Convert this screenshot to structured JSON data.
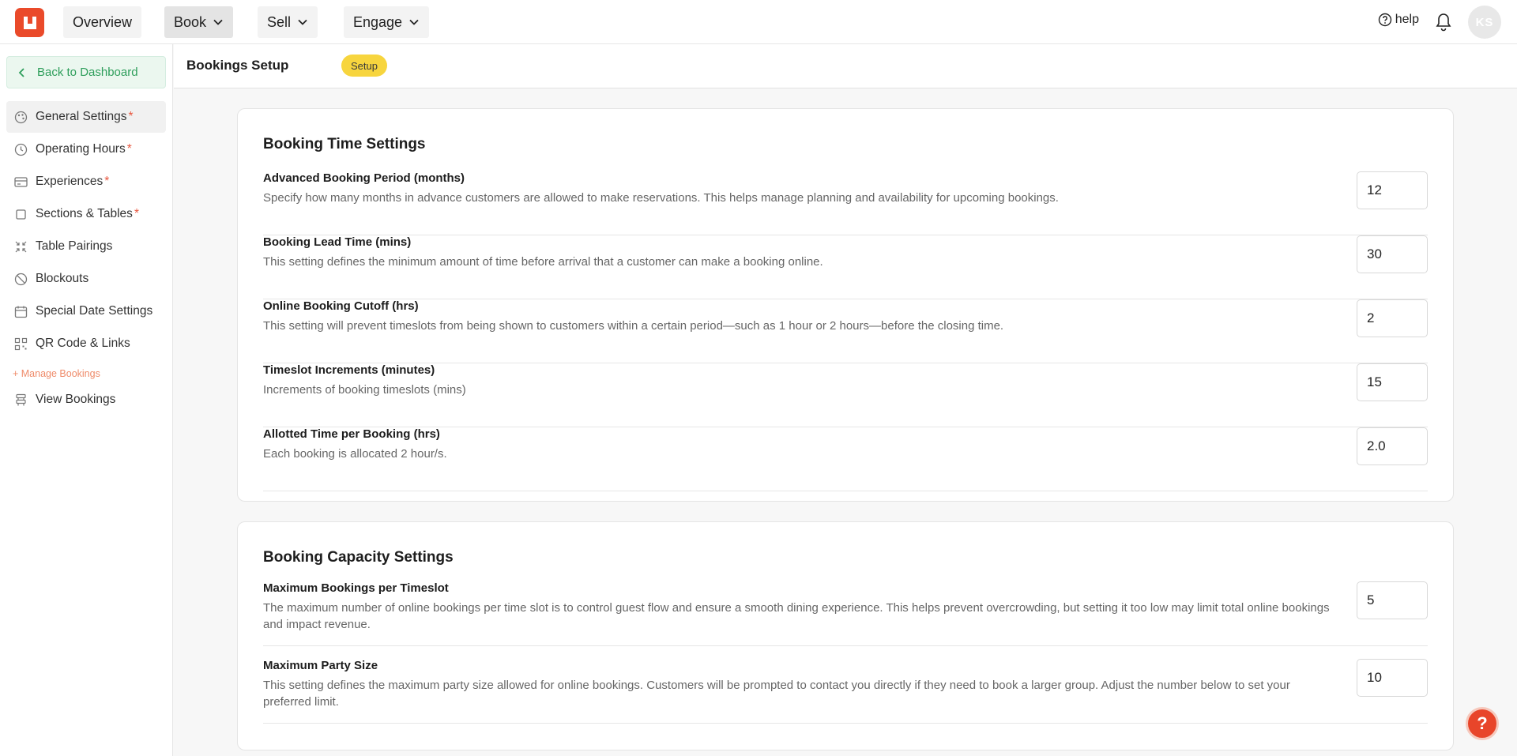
{
  "nav": {
    "items": [
      {
        "label": "Overview"
      },
      {
        "label": "Book"
      },
      {
        "label": "Sell"
      },
      {
        "label": "Engage"
      }
    ],
    "help_label": "help",
    "avatar_initials": "KS"
  },
  "sidebar": {
    "back_label": "Back to Dashboard",
    "items": [
      {
        "label": "General Settings",
        "required": "*"
      },
      {
        "label": "Operating Hours",
        "required": "*"
      },
      {
        "label": "Experiences",
        "required": "*"
      },
      {
        "label": "Sections & Tables",
        "required": "*"
      },
      {
        "label": "Table Pairings"
      },
      {
        "label": "Blockouts"
      },
      {
        "label": "Special Date Settings"
      },
      {
        "label": "QR Code & Links"
      }
    ],
    "section_label": "+ Manage Bookings",
    "manage_items": [
      {
        "label": "View Bookings"
      }
    ]
  },
  "header": {
    "title": "Bookings Setup",
    "badge": "Setup"
  },
  "time_settings": {
    "title": "Booking Time Settings",
    "rows": [
      {
        "label": "Advanced Booking Period (months)",
        "desc": "Specify how many months in advance customers are allowed to make reservations. This helps manage planning and availability for upcoming bookings.",
        "value": "12"
      },
      {
        "label": "Booking Lead Time (mins)",
        "desc": "This setting defines the minimum amount of time before arrival that a customer can make a booking online.",
        "value": "30"
      },
      {
        "label": "Online Booking Cutoff (hrs)",
        "desc": "This setting will prevent timeslots from being shown to customers within a certain period—such as 1 hour or 2 hours—before the closing time.",
        "value": "2"
      },
      {
        "label": "Timeslot Increments (minutes)",
        "desc": "Increments of booking timeslots (mins)",
        "value": "15"
      },
      {
        "label": "Allotted Time per Booking (hrs)",
        "desc": "Each booking is allocated 2 hour/s.",
        "value": "2.0"
      }
    ]
  },
  "capacity_settings": {
    "title": "Booking Capacity Settings",
    "rows": [
      {
        "label": "Maximum Bookings per Timeslot",
        "desc": "The maximum number of online bookings per time slot is to control guest flow and ensure a smooth dining experience. This helps prevent overcrowding, but setting it too low may limit total online bookings and impact revenue.",
        "value": "5"
      },
      {
        "label": "Maximum Party Size",
        "desc": "This setting defines the maximum party size allowed for online bookings. Customers will be prompted to contact you directly if they need to book a larger group. Adjust the number below to set your preferred limit.",
        "value": "10"
      }
    ]
  },
  "fab_label": "?",
  "colors": {
    "brand": "#ea4a2a",
    "back_button_text": "#2e9e5b",
    "badge": "#f7d53e",
    "required": "#e8573f"
  }
}
